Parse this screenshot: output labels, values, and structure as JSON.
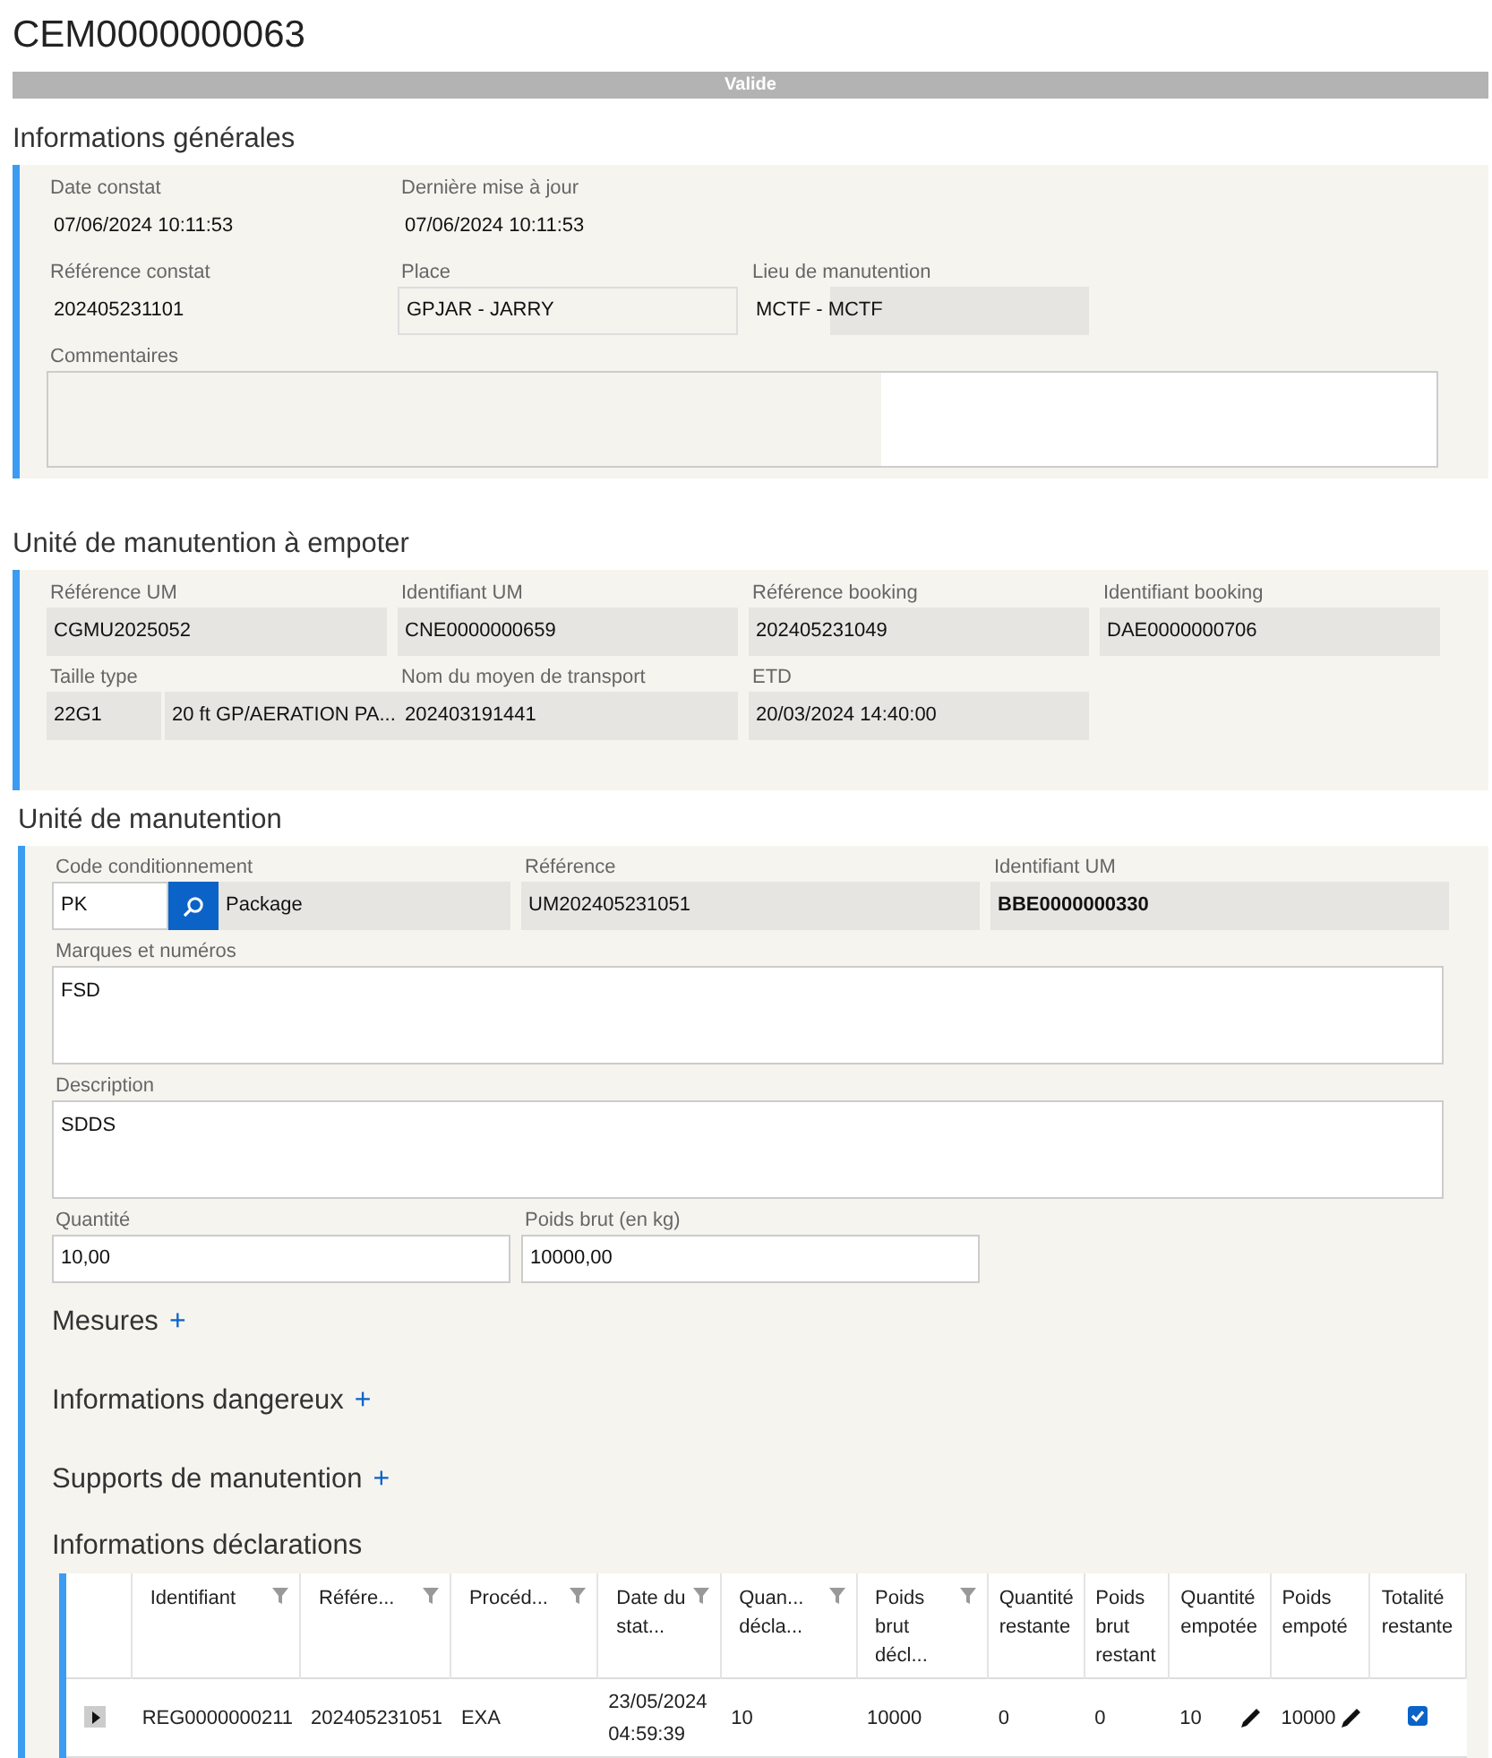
{
  "title": "CEM0000000063",
  "status": "Valide",
  "sections": [
    {
      "heading": "Informations générales",
      "kind": "summary",
      "rows": [
        [
          {
            "kind": "plain",
            "label": "Date constat",
            "value": "07/06/2024 10:11:53"
          },
          {
            "kind": "plain",
            "label": "Dernière mise à jour",
            "value": "07/06/2024 10:11:53"
          }
        ],
        [
          {
            "kind": "plain",
            "label": "Référence constat",
            "value": "202405231101"
          },
          {
            "kind": "outlined",
            "label": "Place",
            "value": "GPJAR - JARRY"
          },
          {
            "kind": "partial",
            "label": "Lieu de manutention",
            "value": "MCTF - MCTF"
          }
        ],
        [
          {
            "kind": "comment",
            "label": "Commentaires"
          }
        ]
      ]
    },
    {
      "heading": "Unité de manutention à empoter",
      "kind": "summary",
      "rows": [
        [
          {
            "kind": "readonly",
            "label": "Référence UM",
            "value": "CGMU2025052"
          },
          {
            "kind": "readonly",
            "label": "Identifiant UM",
            "value": "CNE0000000659"
          },
          {
            "kind": "readonly",
            "label": "Référence booking",
            "value": "202405231049"
          },
          {
            "kind": "readonly",
            "label": "Identifiant booking",
            "value": "DAE0000000706"
          }
        ],
        [
          {
            "kind": "split",
            "label": "Taille type",
            "values": [
              "22G1",
              "20 ft GP/AERATION PA..."
            ]
          },
          {
            "kind": "readonly",
            "label": "Nom du moyen de transport",
            "value": "202403191441"
          },
          {
            "kind": "readonly",
            "label": "ETD",
            "value": "20/03/2024 14:40:00"
          }
        ]
      ]
    },
    {
      "heading": "Unité de manutention",
      "kind": "detail",
      "rows": [
        [
          {
            "kind": "lookup",
            "label": "Code conditionnement",
            "values": [
              "PK",
              "Package"
            ]
          },
          {
            "kind": "readonly",
            "label": "Référence",
            "value": "UM202405231051"
          },
          {
            "kind": "readonly-strong",
            "label": "Identifiant UM",
            "value": "BBE0000000330"
          }
        ],
        [
          {
            "kind": "textarea",
            "label": "Marques et numéros",
            "value": "FSD"
          }
        ],
        [
          {
            "kind": "textarea",
            "label": "Description",
            "value": "SDDS"
          }
        ],
        [
          {
            "kind": "input",
            "label": "Quantité",
            "value": "10,00"
          },
          {
            "kind": "input",
            "label": "Poids brut (en kg)",
            "value": "10000,00"
          }
        ]
      ],
      "subsections": [
        {
          "title": "Mesures",
          "action": "+"
        },
        {
          "title": "Informations dangereux",
          "action": "+"
        },
        {
          "title": "Supports de manutention",
          "action": "+"
        },
        {
          "title": "Informations déclarations"
        }
      ],
      "declarations": {
        "columns": [
          {
            "label": "Identifiant",
            "filter": true,
            "editable": false,
            "kind": "text"
          },
          {
            "label": "Référe...",
            "filter": true,
            "editable": false,
            "kind": "text"
          },
          {
            "label": "Procéd...",
            "filter": true,
            "editable": false,
            "kind": "text"
          },
          {
            "label": "Date du stat...",
            "filter": true,
            "editable": false,
            "kind": "text"
          },
          {
            "label": "Quan... décla...",
            "filter": true,
            "editable": false,
            "kind": "text"
          },
          {
            "label": "Poids brut décl...",
            "filter": true,
            "editable": false,
            "kind": "text"
          },
          {
            "label": "Quantité restante",
            "filter": false,
            "editable": false,
            "kind": "text"
          },
          {
            "label": "Poids brut restant",
            "filter": false,
            "editable": false,
            "kind": "text"
          },
          {
            "label": "Quantité empotée",
            "filter": false,
            "editable": true,
            "kind": "text"
          },
          {
            "label": "Poids empoté",
            "filter": false,
            "editable": true,
            "kind": "text"
          },
          {
            "label": "Totalité restante",
            "filter": false,
            "editable": false,
            "kind": "checkbox"
          }
        ],
        "rows": [
          {
            "expanded": false,
            "checked": true,
            "cells": [
              "REG0000000211",
              "202405231051",
              "EXA",
              "23/05/2024 04:59:39",
              "10",
              "10000",
              "0",
              "0",
              "10",
              "10000"
            ]
          }
        ]
      }
    }
  ]
}
